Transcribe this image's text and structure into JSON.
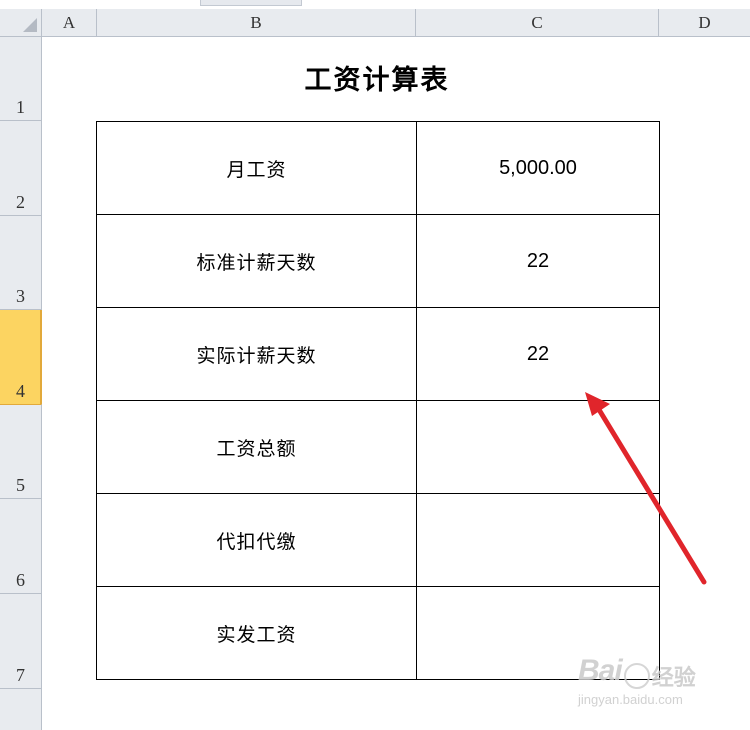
{
  "sheet": {
    "title": "工资计算表",
    "columns": [
      "A",
      "B",
      "C",
      "D"
    ],
    "rows": [
      "1",
      "2",
      "3",
      "4",
      "5",
      "6",
      "7"
    ],
    "selected_row": "4",
    "table": [
      {
        "label": "月工资",
        "value": "5,000.00"
      },
      {
        "label": "标准计薪天数",
        "value": "22"
      },
      {
        "label": "实际计薪天数",
        "value": "22"
      },
      {
        "label": "工资总额",
        "value": ""
      },
      {
        "label": "代扣代缴",
        "value": ""
      },
      {
        "label": "实发工资",
        "value": ""
      }
    ]
  },
  "annotation": {
    "arrow_color": "#e0252b"
  },
  "watermark": {
    "brand": "Bai",
    "suffix": "经验",
    "url": "jingyan.baidu.com"
  }
}
